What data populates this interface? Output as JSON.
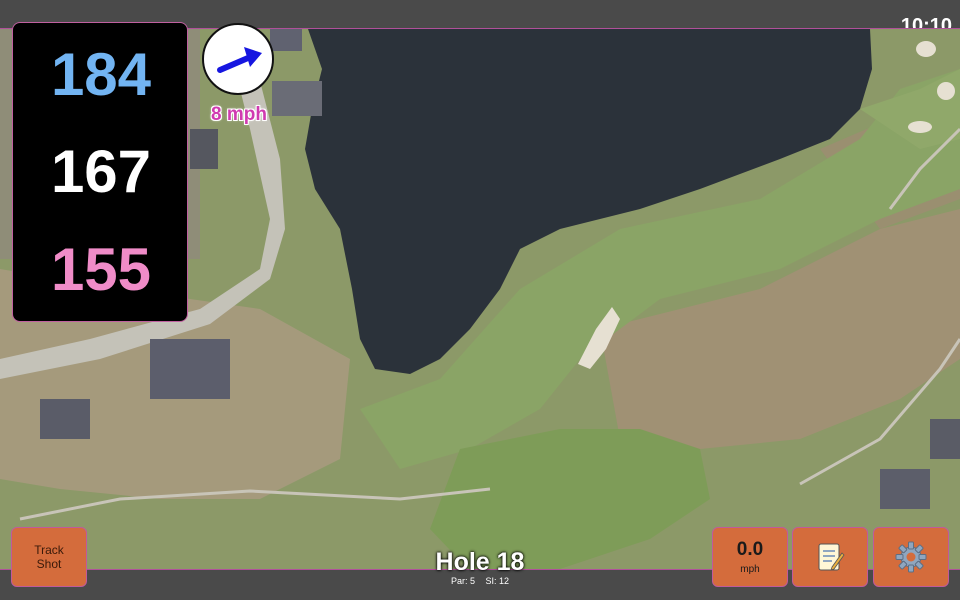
{
  "status": {
    "time": "10:10"
  },
  "distances": {
    "back": "184",
    "middle": "167",
    "front": "155"
  },
  "wind": {
    "speed": "8 mph",
    "arrow_icon": "wind-direction-arrow"
  },
  "hole": {
    "title": "Hole 18",
    "par": "Par: 5",
    "si": "SI: 12"
  },
  "buttons": {
    "track_shot_line1": "Track",
    "track_shot_line2": "Shot",
    "speed_value": "0.0",
    "speed_unit": "mph",
    "notes_icon": "notepad-icon",
    "settings_icon": "gear-icon"
  },
  "colors": {
    "back_distance": "#72b4f2",
    "middle_distance": "#ffffff",
    "front_distance": "#f08cc8",
    "button_bg": "#d46c3c",
    "wind_label": "#d03ab0"
  }
}
